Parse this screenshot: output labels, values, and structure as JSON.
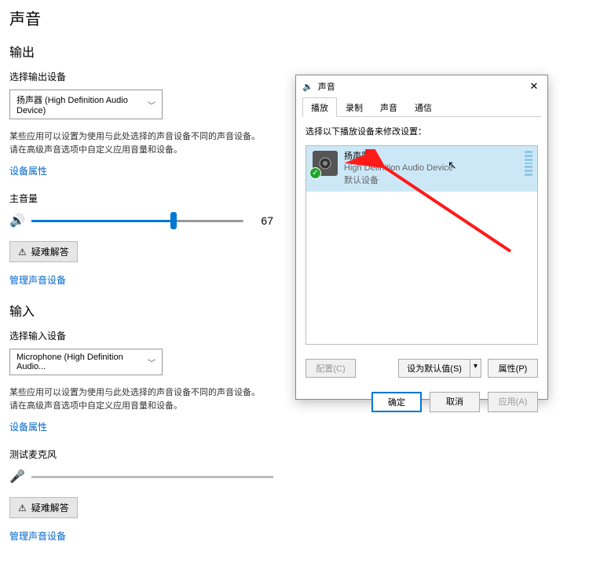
{
  "page": {
    "title": "声音"
  },
  "output": {
    "heading": "输出",
    "select_label": "选择输出设备",
    "device": "扬声器 (High Definition Audio Device)",
    "desc": "某些应用可以设置为使用与此处选择的声音设备不同的声音设备。请在高级声音选项中自定义应用音量和设备。",
    "props_link": "设备属性",
    "volume_label": "主音量",
    "volume_value": "67",
    "volume_pct": 67,
    "trouble_btn": "疑难解答",
    "manage_link": "管理声音设备"
  },
  "input": {
    "heading": "输入",
    "select_label": "选择输入设备",
    "device": "Microphone (High Definition Audio...",
    "desc": "某些应用可以设置为使用与此处选择的声音设备不同的声音设备。请在高级声音选项中自定义应用音量和设备。",
    "props_link": "设备属性",
    "mic_test_label": "测试麦克风",
    "trouble_btn": "疑难解答",
    "manage_link": "管理声音设备"
  },
  "dialog": {
    "title": "声音",
    "tabs": {
      "playback": "播放",
      "record": "录制",
      "sounds": "声音",
      "comm": "通信"
    },
    "hint": "选择以下播放设备来修改设置：",
    "device": {
      "name": "扬声器",
      "sub": "High Definition Audio Device",
      "default": "默认设备"
    },
    "buttons": {
      "configure": "配置(C)",
      "set_default": "设为默认值(S)",
      "properties": "属性(P)",
      "ok": "确定",
      "cancel": "取消",
      "apply": "应用(A)"
    }
  }
}
